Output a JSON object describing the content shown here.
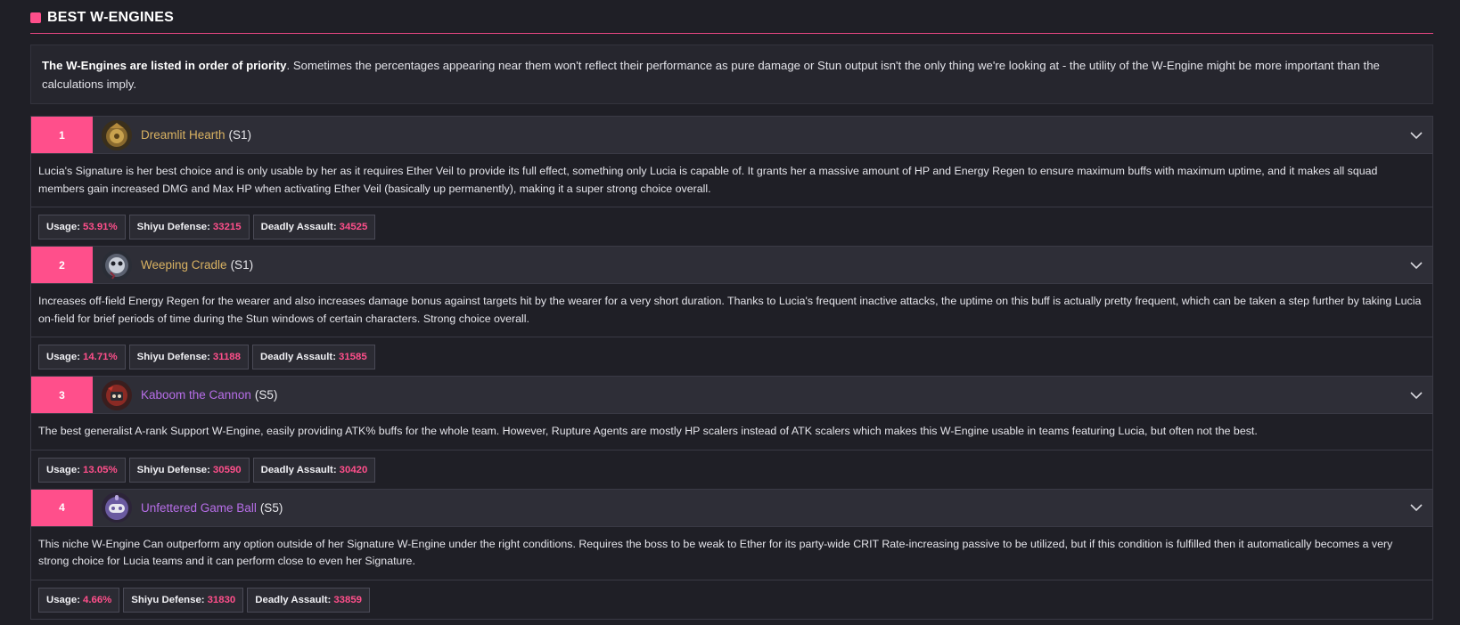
{
  "section": {
    "title": "BEST W-ENGINES"
  },
  "intro": {
    "bold": "The W-Engines are listed in order of priority",
    "rest": ". Sometimes the percentages appearing near them won't reflect their performance as pure damage or Stun output isn't the only thing we're looking at - the utility of the W-Engine might be more important than the calculations imply."
  },
  "colors": {
    "accent": "#ff4f8b",
    "gold": "#d9b262",
    "purple": "#b76ee8"
  },
  "stat_labels": {
    "usage": "Usage:",
    "shiyu": "Shiyu Defense:",
    "deadly": "Deadly Assault:"
  },
  "engines": [
    {
      "rank": "1",
      "icon": "dreamlit-hearth-icon",
      "name": "Dreamlit Hearth",
      "refine": "(S1)",
      "rarity": "S",
      "description": "Lucia's Signature is her best choice and is only usable by her as it requires Ether Veil to provide its full effect, something only Lucia is capable of. It grants her a massive amount of HP and Energy Regen to ensure maximum buffs with maximum uptime, and it makes all squad members gain increased DMG and Max HP when activating Ether Veil (basically up permanently), making it a super strong choice overall.",
      "usage": "53.91%",
      "shiyu": "33215",
      "deadly": "34525"
    },
    {
      "rank": "2",
      "icon": "weeping-cradle-icon",
      "name": "Weeping Cradle",
      "refine": "(S1)",
      "rarity": "S",
      "description": "Increases off-field Energy Regen for the wearer and also increases damage bonus against targets hit by the wearer for a very short duration. Thanks to Lucia's frequent inactive attacks, the uptime on this buff is actually pretty frequent, which can be taken a step further by taking Lucia on-field for brief periods of time during the Stun windows of certain characters. Strong choice overall.",
      "usage": "14.71%",
      "shiyu": "31188",
      "deadly": "31585"
    },
    {
      "rank": "3",
      "icon": "kaboom-the-cannon-icon",
      "name": "Kaboom the Cannon",
      "refine": "(S5)",
      "rarity": "A",
      "description": "The best generalist A-rank Support W-Engine, easily providing ATK% buffs for the whole team. However, Rupture Agents are mostly HP scalers instead of ATK scalers which makes this W-Engine usable in teams featuring Lucia, but often not the best.",
      "usage": "13.05%",
      "shiyu": "30590",
      "deadly": "30420"
    },
    {
      "rank": "4",
      "icon": "unfettered-game-ball-icon",
      "name": "Unfettered Game Ball",
      "refine": "(S5)",
      "rarity": "A",
      "description": "This niche W-Engine Can outperform any option outside of her Signature W-Engine under the right conditions. Requires the boss to be weak to Ether for its party-wide CRIT Rate-increasing passive to be utilized, but if this condition is fulfilled then it automatically becomes a very strong choice for Lucia teams and it can perform close to even her Signature.",
      "usage": "4.66%",
      "shiyu": "31830",
      "deadly": "33859"
    }
  ]
}
